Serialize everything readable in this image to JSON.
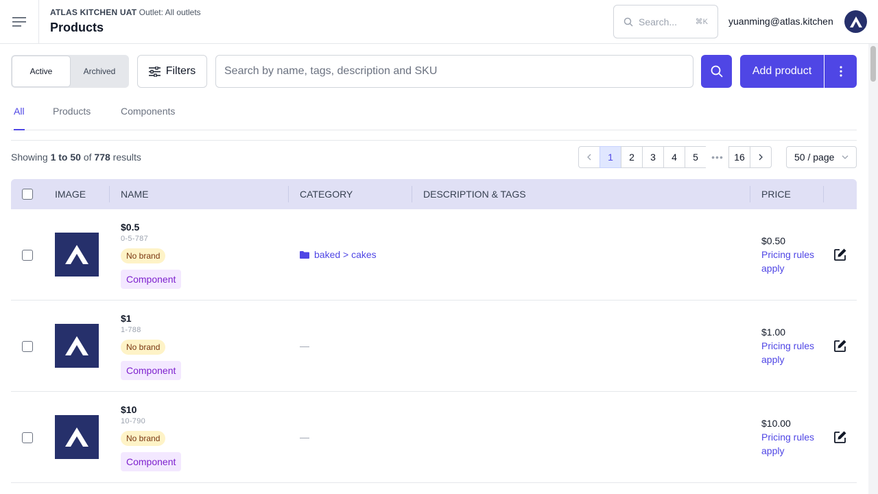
{
  "header": {
    "org": "ATLAS KITCHEN UAT",
    "outlet": "Outlet: All outlets",
    "title": "Products",
    "search_placeholder": "Search...",
    "search_shortcut": "⌘K",
    "user_email": "yuanming@atlas.kitchen"
  },
  "toolbar": {
    "status_active": "Active",
    "status_archived": "Archived",
    "filters_label": "Filters",
    "search_placeholder": "Search by name, tags, description and SKU",
    "add_label": "Add product"
  },
  "tabs": [
    "All",
    "Products",
    "Components"
  ],
  "results": {
    "prefix": "Showing",
    "range": "1 to 50",
    "of": "of",
    "total": "778",
    "suffix": "results"
  },
  "pagination": {
    "pages": [
      "1",
      "2",
      "3",
      "4",
      "5"
    ],
    "ellipsis": "•••",
    "last_page": "16",
    "per_page": "50 / page"
  },
  "table": {
    "columns": [
      "IMAGE",
      "NAME",
      "CATEGORY",
      "DESCRIPTION & TAGS",
      "PRICE"
    ],
    "rows": [
      {
        "name": "$0.5",
        "sku": "0-5-787",
        "brand": "No brand",
        "type": "Component",
        "category": "baked > cakes",
        "price": "$0.50",
        "rules": "Pricing rules apply"
      },
      {
        "name": "$1",
        "sku": "1-788",
        "brand": "No brand",
        "type": "Component",
        "category": "—",
        "price": "$1.00",
        "rules": "Pricing rules apply"
      },
      {
        "name": "$10",
        "sku": "10-790",
        "brand": "No brand",
        "type": "Component",
        "category": "—",
        "price": "$10.00",
        "rules": "Pricing rules apply"
      }
    ]
  },
  "colors": {
    "accent": "#4f46e5",
    "brand_navy": "#26306b",
    "header_row": "#e0e0f5"
  },
  "icons": [
    "menu-icon",
    "search-icon",
    "filter-icon",
    "kebab-icon",
    "chevron-left-icon",
    "chevron-right-icon",
    "chevron-down-icon",
    "folder-icon",
    "edit-icon",
    "atlas-logo-icon"
  ]
}
